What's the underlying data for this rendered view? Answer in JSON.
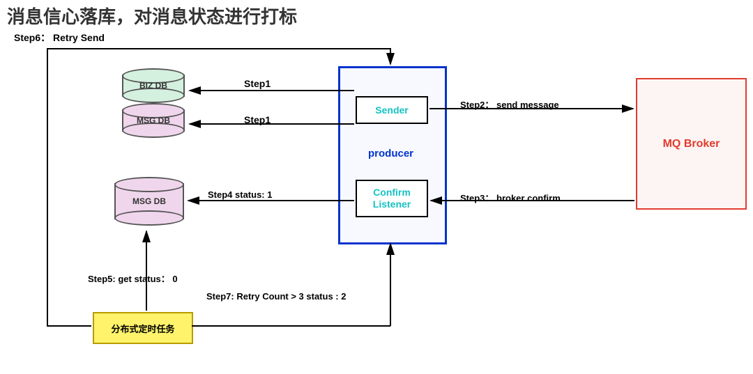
{
  "title": "消息信心落库，对消息状态进行打标",
  "steps": {
    "s1a": "Step1",
    "s1b": "Step1",
    "s2": "Step2： send message",
    "s3": "Step3： broker confirm",
    "s4": "Step4 status: 1",
    "s5": "Step5: get status： 0",
    "s6": "Step6： Retry Send",
    "s7": "Step7: Retry Count > 3 status : 2"
  },
  "nodes": {
    "biz_db": "BIZ DB",
    "msg_db": "MSG DB",
    "sender": "Sender",
    "producer": "producer",
    "confirm_listener": "Confirm\nListener",
    "broker": "MQ Broker",
    "task": "分布式定时任务"
  }
}
